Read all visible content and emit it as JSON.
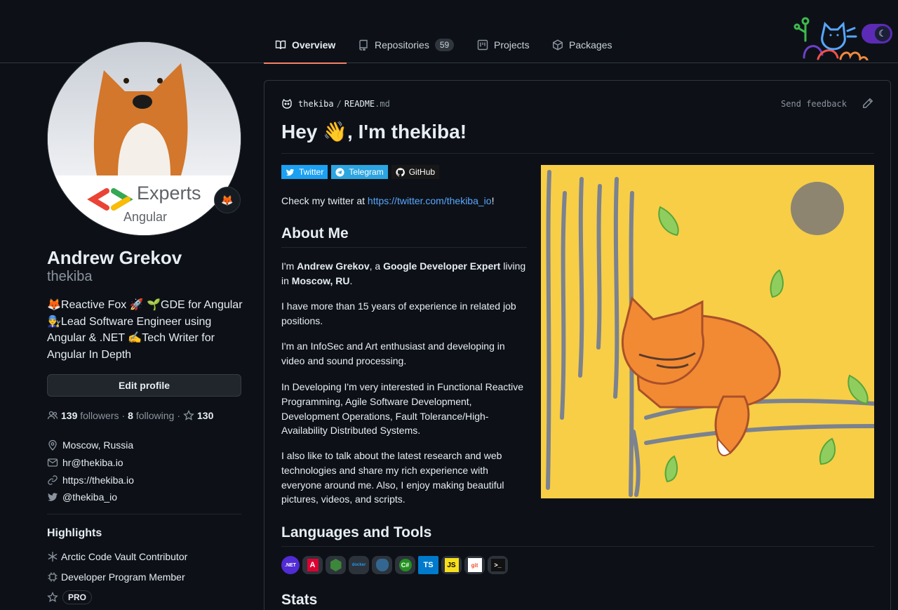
{
  "nav": {
    "tabs": [
      {
        "label": "Overview",
        "active": true
      },
      {
        "label": "Repositories",
        "count": "59"
      },
      {
        "label": "Projects"
      },
      {
        "label": "Packages"
      }
    ]
  },
  "profile": {
    "avatar_text": "Experts",
    "avatar_subtext": "Angular",
    "status_emoji": "🦊",
    "name": "Andrew Grekov",
    "login": "thekiba",
    "bio": "🦊Reactive Fox 🚀 🌱GDE for Angular 👨‍🔧Lead Software Engineer using Angular & .NET ✍️Tech Writer for Angular In Depth",
    "edit_label": "Edit profile",
    "followers_count": "139",
    "followers_label": "followers",
    "following_count": "8",
    "following_label": "following",
    "stars_count": "130",
    "dot": "·",
    "location": "Moscow, Russia",
    "email": "hr@thekiba.io",
    "website": "https://thekiba.io",
    "twitter": "@thekiba_io"
  },
  "highlights": {
    "title": "Highlights",
    "items": [
      "Arctic Code Vault Contributor",
      "Developer Program Member"
    ],
    "pro": "PRO"
  },
  "readme": {
    "owner": "thekiba",
    "slash": "/",
    "file": "README",
    "ext": ".md",
    "send_feedback": "Send feedback",
    "title": "Hey 👋, I'm thekiba!",
    "badges": [
      {
        "label": "Twitter",
        "color": "#1ca0f2"
      },
      {
        "label": "Telegram",
        "color": "#2ca5e0"
      },
      {
        "label": "GitHub",
        "color": "#181717"
      }
    ],
    "twitter_pre": "Check my twitter at ",
    "twitter_link": "https://twitter.com/thekiba_io",
    "twitter_post": "!",
    "about_title": "About Me",
    "about_p1": {
      "a": "I'm ",
      "b": "Andrew Grekov",
      "c": ", a ",
      "d": "Google Developer Expert",
      "e": " living in ",
      "f": "Moscow, RU",
      "g": "."
    },
    "about_p2": "I have more than 15 years of experience in related job positions.",
    "about_p3": "I'm an InfoSec and Art enthusiast and developing in video and sound processing.",
    "about_p4": "In Developing I'm very interested in Functional Reactive Programming, Agile Software Development, Development Operations, Fault Tolerance/High-Availability Distributed Systems.",
    "about_p5": "I also like to talk about the latest research and web technologies and share my rich experience with everyone around me. Also, I enjoy making beautiful pictures, videos, and scripts.",
    "langs_title": "Languages and Tools",
    "tools": [
      ".NET",
      "A",
      "",
      "docker",
      "",
      "C#",
      "TS",
      "JS",
      "git",
      ">_"
    ],
    "stats_title": "Stats"
  },
  "colors": {
    "accent": "#f78166",
    "link": "#58a6ff",
    "art_bg": "#f7ce46"
  }
}
